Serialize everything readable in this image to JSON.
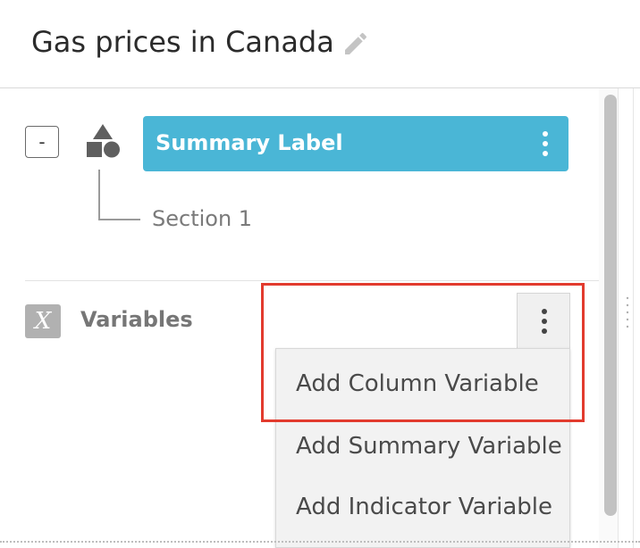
{
  "header": {
    "title": "Gas prices in Canada",
    "edit_icon": "pencil-icon"
  },
  "tree": {
    "collapse_label": "-",
    "node_icon": "shapes-icon",
    "summary_label": "Summary Label",
    "summary_menu_icon": "kebab-icon",
    "section_label": "Section 1"
  },
  "variables": {
    "icon_letter": "X",
    "label": "Variables",
    "menu_icon": "kebab-icon",
    "menu_items": [
      {
        "label": "Add Column Variable"
      },
      {
        "label": "Add Summary Variable"
      },
      {
        "label": "Add Indicator Variable"
      }
    ]
  },
  "colors": {
    "summary_label_bg": "#4ab6d6",
    "highlight_border": "#e23b2e",
    "menu_bg": "#f2f2f2"
  }
}
